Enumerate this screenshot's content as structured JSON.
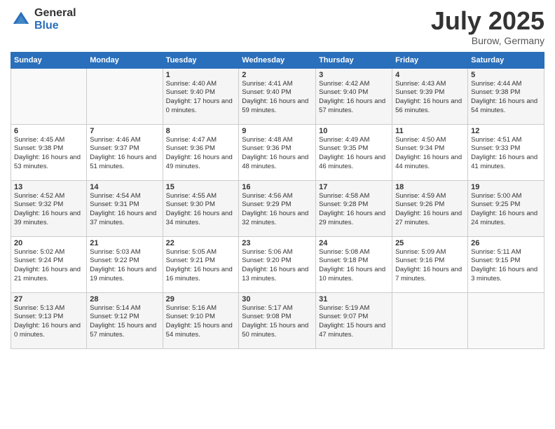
{
  "header": {
    "logo_general": "General",
    "logo_blue": "Blue",
    "title": "July 2025",
    "location": "Burow, Germany"
  },
  "weekdays": [
    "Sunday",
    "Monday",
    "Tuesday",
    "Wednesday",
    "Thursday",
    "Friday",
    "Saturday"
  ],
  "weeks": [
    [
      {
        "day": "",
        "sunrise": "",
        "sunset": "",
        "daylight": ""
      },
      {
        "day": "",
        "sunrise": "",
        "sunset": "",
        "daylight": ""
      },
      {
        "day": "1",
        "sunrise": "Sunrise: 4:40 AM",
        "sunset": "Sunset: 9:40 PM",
        "daylight": "Daylight: 17 hours and 0 minutes."
      },
      {
        "day": "2",
        "sunrise": "Sunrise: 4:41 AM",
        "sunset": "Sunset: 9:40 PM",
        "daylight": "Daylight: 16 hours and 59 minutes."
      },
      {
        "day": "3",
        "sunrise": "Sunrise: 4:42 AM",
        "sunset": "Sunset: 9:40 PM",
        "daylight": "Daylight: 16 hours and 57 minutes."
      },
      {
        "day": "4",
        "sunrise": "Sunrise: 4:43 AM",
        "sunset": "Sunset: 9:39 PM",
        "daylight": "Daylight: 16 hours and 56 minutes."
      },
      {
        "day": "5",
        "sunrise": "Sunrise: 4:44 AM",
        "sunset": "Sunset: 9:38 PM",
        "daylight": "Daylight: 16 hours and 54 minutes."
      }
    ],
    [
      {
        "day": "6",
        "sunrise": "Sunrise: 4:45 AM",
        "sunset": "Sunset: 9:38 PM",
        "daylight": "Daylight: 16 hours and 53 minutes."
      },
      {
        "day": "7",
        "sunrise": "Sunrise: 4:46 AM",
        "sunset": "Sunset: 9:37 PM",
        "daylight": "Daylight: 16 hours and 51 minutes."
      },
      {
        "day": "8",
        "sunrise": "Sunrise: 4:47 AM",
        "sunset": "Sunset: 9:36 PM",
        "daylight": "Daylight: 16 hours and 49 minutes."
      },
      {
        "day": "9",
        "sunrise": "Sunrise: 4:48 AM",
        "sunset": "Sunset: 9:36 PM",
        "daylight": "Daylight: 16 hours and 48 minutes."
      },
      {
        "day": "10",
        "sunrise": "Sunrise: 4:49 AM",
        "sunset": "Sunset: 9:35 PM",
        "daylight": "Daylight: 16 hours and 46 minutes."
      },
      {
        "day": "11",
        "sunrise": "Sunrise: 4:50 AM",
        "sunset": "Sunset: 9:34 PM",
        "daylight": "Daylight: 16 hours and 44 minutes."
      },
      {
        "day": "12",
        "sunrise": "Sunrise: 4:51 AM",
        "sunset": "Sunset: 9:33 PM",
        "daylight": "Daylight: 16 hours and 41 minutes."
      }
    ],
    [
      {
        "day": "13",
        "sunrise": "Sunrise: 4:52 AM",
        "sunset": "Sunset: 9:32 PM",
        "daylight": "Daylight: 16 hours and 39 minutes."
      },
      {
        "day": "14",
        "sunrise": "Sunrise: 4:54 AM",
        "sunset": "Sunset: 9:31 PM",
        "daylight": "Daylight: 16 hours and 37 minutes."
      },
      {
        "day": "15",
        "sunrise": "Sunrise: 4:55 AM",
        "sunset": "Sunset: 9:30 PM",
        "daylight": "Daylight: 16 hours and 34 minutes."
      },
      {
        "day": "16",
        "sunrise": "Sunrise: 4:56 AM",
        "sunset": "Sunset: 9:29 PM",
        "daylight": "Daylight: 16 hours and 32 minutes."
      },
      {
        "day": "17",
        "sunrise": "Sunrise: 4:58 AM",
        "sunset": "Sunset: 9:28 PM",
        "daylight": "Daylight: 16 hours and 29 minutes."
      },
      {
        "day": "18",
        "sunrise": "Sunrise: 4:59 AM",
        "sunset": "Sunset: 9:26 PM",
        "daylight": "Daylight: 16 hours and 27 minutes."
      },
      {
        "day": "19",
        "sunrise": "Sunrise: 5:00 AM",
        "sunset": "Sunset: 9:25 PM",
        "daylight": "Daylight: 16 hours and 24 minutes."
      }
    ],
    [
      {
        "day": "20",
        "sunrise": "Sunrise: 5:02 AM",
        "sunset": "Sunset: 9:24 PM",
        "daylight": "Daylight: 16 hours and 21 minutes."
      },
      {
        "day": "21",
        "sunrise": "Sunrise: 5:03 AM",
        "sunset": "Sunset: 9:22 PM",
        "daylight": "Daylight: 16 hours and 19 minutes."
      },
      {
        "day": "22",
        "sunrise": "Sunrise: 5:05 AM",
        "sunset": "Sunset: 9:21 PM",
        "daylight": "Daylight: 16 hours and 16 minutes."
      },
      {
        "day": "23",
        "sunrise": "Sunrise: 5:06 AM",
        "sunset": "Sunset: 9:20 PM",
        "daylight": "Daylight: 16 hours and 13 minutes."
      },
      {
        "day": "24",
        "sunrise": "Sunrise: 5:08 AM",
        "sunset": "Sunset: 9:18 PM",
        "daylight": "Daylight: 16 hours and 10 minutes."
      },
      {
        "day": "25",
        "sunrise": "Sunrise: 5:09 AM",
        "sunset": "Sunset: 9:16 PM",
        "daylight": "Daylight: 16 hours and 7 minutes."
      },
      {
        "day": "26",
        "sunrise": "Sunrise: 5:11 AM",
        "sunset": "Sunset: 9:15 PM",
        "daylight": "Daylight: 16 hours and 3 minutes."
      }
    ],
    [
      {
        "day": "27",
        "sunrise": "Sunrise: 5:13 AM",
        "sunset": "Sunset: 9:13 PM",
        "daylight": "Daylight: 16 hours and 0 minutes."
      },
      {
        "day": "28",
        "sunrise": "Sunrise: 5:14 AM",
        "sunset": "Sunset: 9:12 PM",
        "daylight": "Daylight: 15 hours and 57 minutes."
      },
      {
        "day": "29",
        "sunrise": "Sunrise: 5:16 AM",
        "sunset": "Sunset: 9:10 PM",
        "daylight": "Daylight: 15 hours and 54 minutes."
      },
      {
        "day": "30",
        "sunrise": "Sunrise: 5:17 AM",
        "sunset": "Sunset: 9:08 PM",
        "daylight": "Daylight: 15 hours and 50 minutes."
      },
      {
        "day": "31",
        "sunrise": "Sunrise: 5:19 AM",
        "sunset": "Sunset: 9:07 PM",
        "daylight": "Daylight: 15 hours and 47 minutes."
      },
      {
        "day": "",
        "sunrise": "",
        "sunset": "",
        "daylight": ""
      },
      {
        "day": "",
        "sunrise": "",
        "sunset": "",
        "daylight": ""
      }
    ]
  ]
}
